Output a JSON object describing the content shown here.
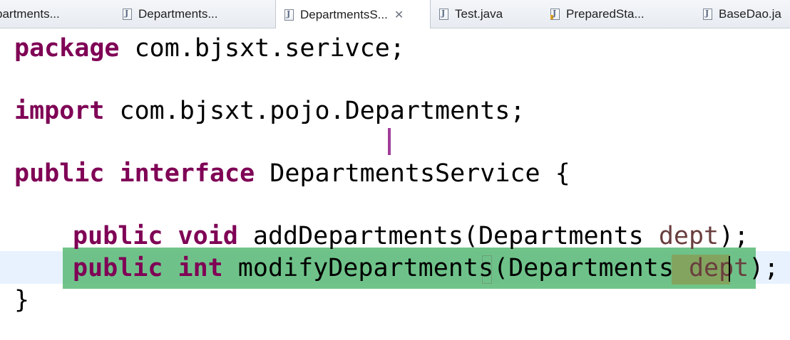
{
  "tabs": [
    {
      "label": "partments...",
      "active": false,
      "locked": false
    },
    {
      "label": "Departments...",
      "active": false,
      "locked": false
    },
    {
      "label": "DepartmentsS...",
      "active": true,
      "locked": false
    },
    {
      "label": "Test.java",
      "active": false,
      "locked": false
    },
    {
      "label": "PreparedSta...",
      "active": false,
      "locked": true
    },
    {
      "label": "BaseDao.ja",
      "active": false,
      "locked": false
    }
  ],
  "tab_close_glyph": "✕",
  "code": {
    "line1": {
      "kw": "package",
      "rest": " com.bjsxt.serivce;"
    },
    "line3": {
      "kw": "import",
      "rest": " com.bjsxt.pojo.Departments;"
    },
    "line5": {
      "kw1": "public",
      "kw2": "interface",
      "rest": " DepartmentsService {"
    },
    "line7": {
      "kw1": "public",
      "kw2": "void",
      "method": " addDepartments(Departments ",
      "param": "dept",
      "end": ");"
    },
    "line8": {
      "kw1": "public",
      "kw2": "int",
      "method": " modifyDepartments(Departments ",
      "param": "dept",
      "end": ");"
    },
    "line9": {
      "text": "}"
    }
  },
  "colors": {
    "keyword": "#7f0055",
    "parameter": "#6a3e3e",
    "current_line": "#e8f2fe",
    "selection": "#58ba74",
    "marker": "#a23d9a"
  }
}
